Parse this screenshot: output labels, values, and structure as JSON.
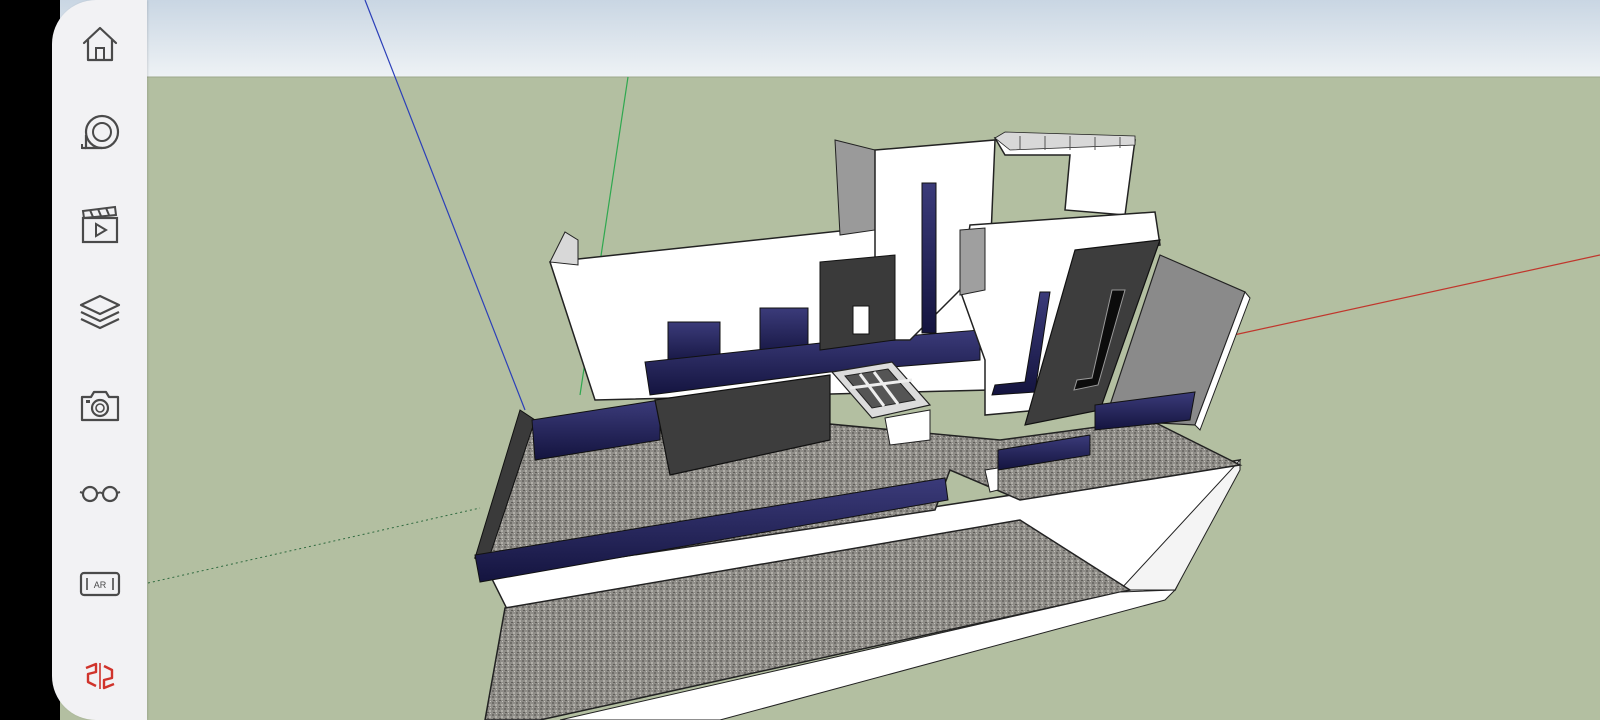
{
  "app": {
    "name": "SketchUp"
  },
  "toolbar": {
    "items": [
      {
        "icon": "home-icon"
      },
      {
        "icon": "tape-measure-icon"
      },
      {
        "icon": "scenes-icon"
      },
      {
        "icon": "layers-icon"
      },
      {
        "icon": "camera-icon"
      },
      {
        "icon": "glasses-icon"
      },
      {
        "icon": "ar-icon",
        "label": "AR"
      },
      {
        "icon": "sketchup-logo-icon"
      }
    ]
  },
  "colors": {
    "sky_top": "#c9d6e3",
    "sky_bottom": "#e9eef2",
    "ground": "#b3bfa1",
    "toolbar_bg": "#f2f2f4",
    "icon_stroke": "#4a4a4a",
    "logo_red": "#d0332b",
    "axis_red": "#c0362c",
    "axis_green": "#2fa84f",
    "axis_blue": "#2b3fb8",
    "wall_white": "#ffffff",
    "wall_gray": "#8a8a8a",
    "wall_dark": "#3a3a3a",
    "glass_navy": "#1e1e5a",
    "gravel": "#8f8d88"
  }
}
